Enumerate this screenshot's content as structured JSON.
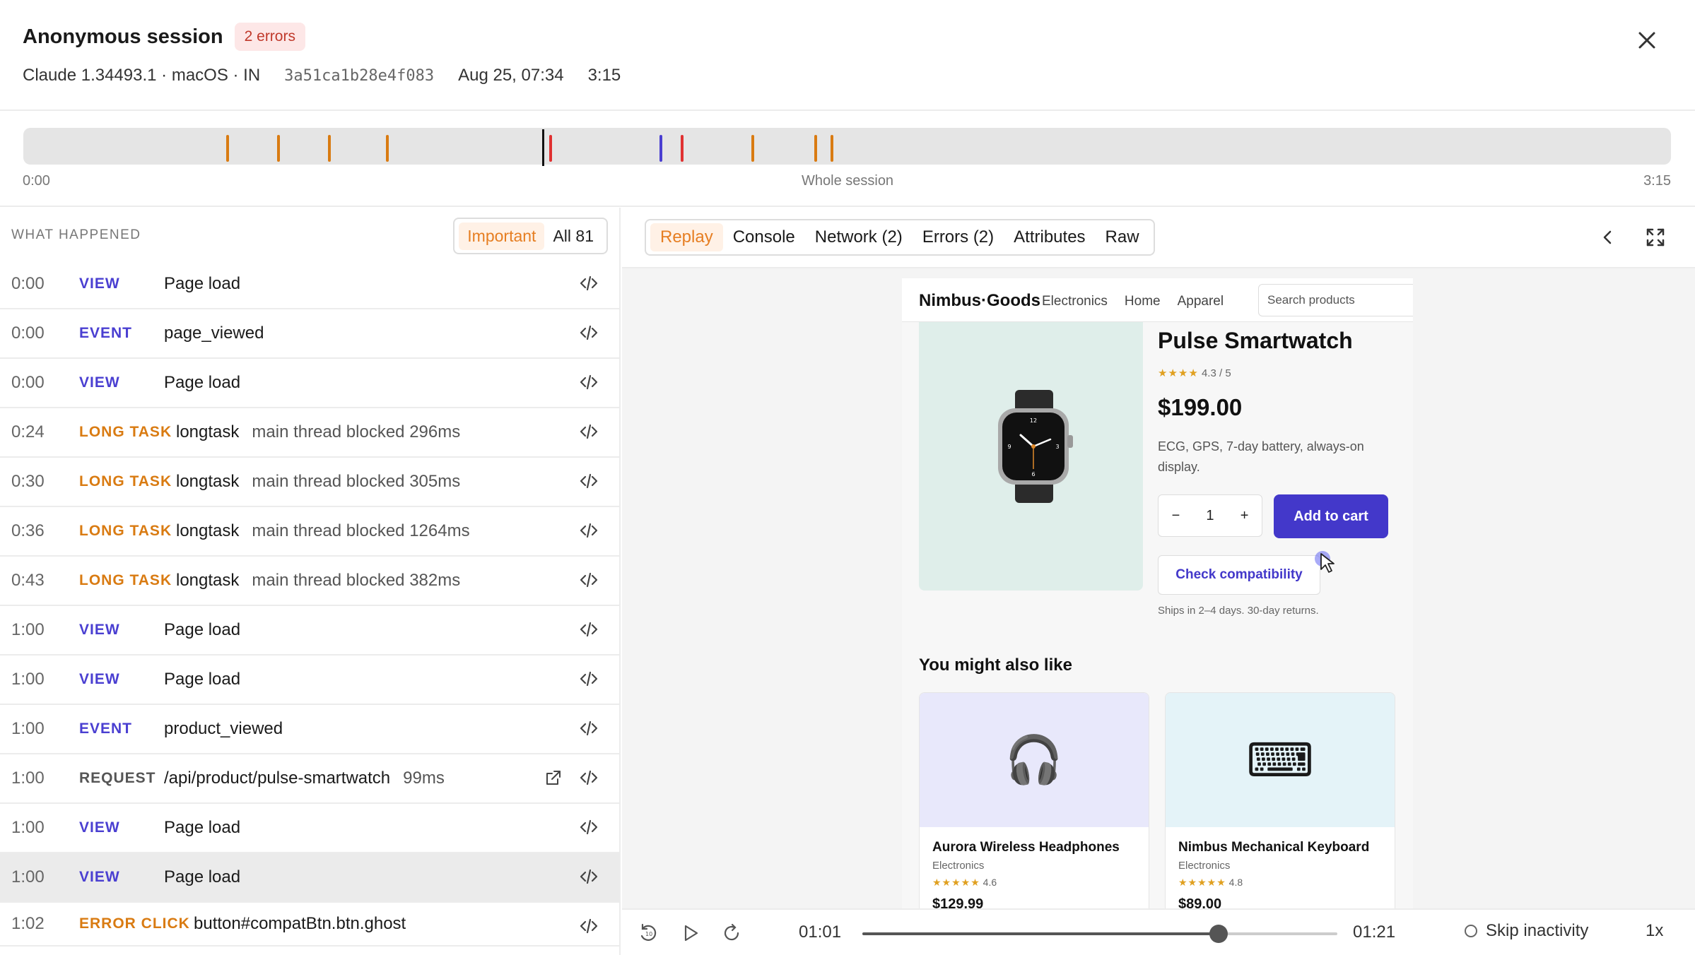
{
  "header": {
    "title": "Anonymous session",
    "error_badge": "2 errors",
    "client": "Claude 1.34493.1 · macOS · IN",
    "session_id": "3a51ca1b28e4f083",
    "date": "Aug 25, 07:34",
    "duration": "3:15",
    "close_icon": "close-icon"
  },
  "timeline": {
    "start_label": "0:00",
    "mid_label": "Whole session",
    "end_label": "3:15",
    "playhead_fraction": 0.315,
    "colors": {
      "long_task": "#d97b12",
      "error": "#e03131",
      "view": "#4a3fd1"
    },
    "markers": [
      {
        "fraction": 0.123,
        "kind": "long_task"
      },
      {
        "fraction": 0.154,
        "kind": "long_task"
      },
      {
        "fraction": 0.185,
        "kind": "long_task"
      },
      {
        "fraction": 0.22,
        "kind": "long_task"
      },
      {
        "fraction": 0.319,
        "kind": "error"
      },
      {
        "fraction": 0.386,
        "kind": "view"
      },
      {
        "fraction": 0.399,
        "kind": "error"
      },
      {
        "fraction": 0.442,
        "kind": "long_task"
      },
      {
        "fraction": 0.48,
        "kind": "long_task"
      },
      {
        "fraction": 0.49,
        "kind": "long_task"
      }
    ]
  },
  "left": {
    "heading": "WHAT HAPPENED",
    "filter_important": "Important",
    "filter_all": "All 81",
    "rows": [
      {
        "time": "0:00",
        "type": "VIEW",
        "text": "Page load",
        "sub": ""
      },
      {
        "time": "0:00",
        "type": "EVENT",
        "text": "page_viewed",
        "sub": ""
      },
      {
        "time": "0:00",
        "type": "VIEW",
        "text": "Page load",
        "sub": ""
      },
      {
        "time": "0:24",
        "type": "LONG TASK",
        "text": "longtask",
        "sub": "main thread blocked 296ms"
      },
      {
        "time": "0:30",
        "type": "LONG TASK",
        "text": "longtask",
        "sub": "main thread blocked 305ms"
      },
      {
        "time": "0:36",
        "type": "LONG TASK",
        "text": "longtask",
        "sub": "main thread blocked 1264ms"
      },
      {
        "time": "0:43",
        "type": "LONG TASK",
        "text": "longtask",
        "sub": "main thread blocked 382ms"
      },
      {
        "time": "1:00",
        "type": "VIEW",
        "text": "Page load",
        "sub": ""
      },
      {
        "time": "1:00",
        "type": "VIEW",
        "text": "Page load",
        "sub": ""
      },
      {
        "time": "1:00",
        "type": "EVENT",
        "text": "product_viewed",
        "sub": ""
      },
      {
        "time": "1:00",
        "type": "REQUEST",
        "text": "/api/product/pulse-smartwatch",
        "sub": "99ms"
      },
      {
        "time": "1:00",
        "type": "VIEW",
        "text": "Page load",
        "sub": ""
      },
      {
        "time": "1:00",
        "type": "VIEW",
        "text": "Page load",
        "sub": ""
      },
      {
        "time": "1:02",
        "type": "ERROR CLICK",
        "text": "button#compatBtn.btn.ghost",
        "sub": ""
      }
    ]
  },
  "right": {
    "tabs": [
      "Replay",
      "Console",
      "Network (2)",
      "Errors (2)",
      "Attributes",
      "Raw"
    ],
    "active_tab": "Replay"
  },
  "replay": {
    "brand": "Nimbus·Goods",
    "nav": [
      "Electronics",
      "Home",
      "Apparel"
    ],
    "search_placeholder": "Search products",
    "product_name": "Pulse Smartwatch",
    "rating": "4.3 / 5",
    "stars": "★★★★",
    "price": "$199.00",
    "description": "ECG, GPS, 7-day battery, always-on display.",
    "qty_minus": "−",
    "qty_value": "1",
    "qty_plus": "+",
    "add_to_cart": "Add to cart",
    "check_compat": "Check compatibility",
    "shipping": "Ships in 2–4 days. 30-day returns.",
    "also_like": "You might also like",
    "cards": [
      {
        "name": "Aurora Wireless Headphones",
        "category": "Electronics",
        "stars": "★★★★★",
        "rating": "4.6",
        "price": "$129.99",
        "emoji": "🎧",
        "bg": "#e8e8fb"
      },
      {
        "name": "Nimbus Mechanical Keyboard",
        "category": "Electronics",
        "stars": "★★★★★",
        "rating": "4.8",
        "price": "$89.00",
        "emoji": "⌨",
        "bg": "#e4f3f8"
      }
    ]
  },
  "player": {
    "current_time": "01:01",
    "end_time": "01:21",
    "progress_fraction": 0.75,
    "skip_inactivity": "Skip inactivity",
    "speed": "1x"
  }
}
